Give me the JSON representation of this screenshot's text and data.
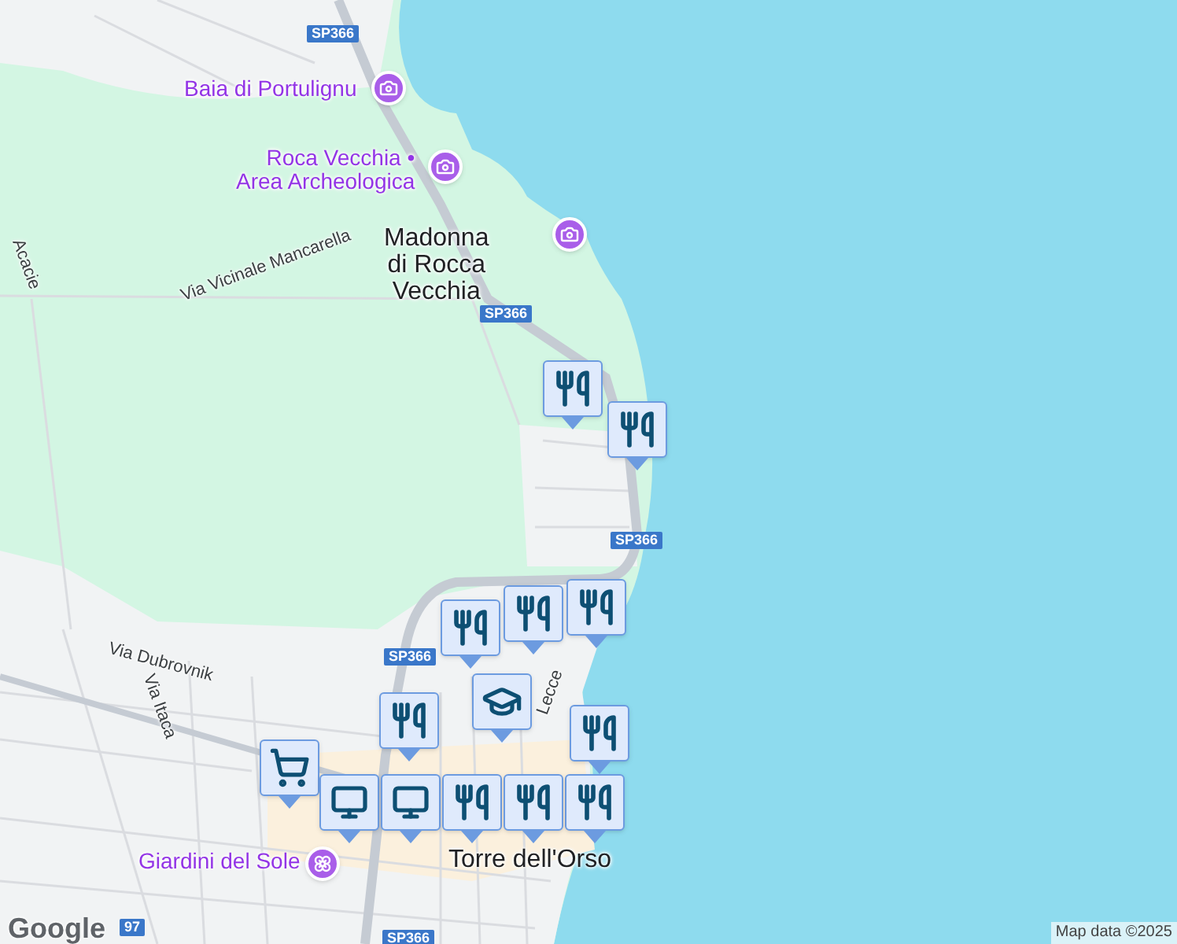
{
  "map": {
    "labels": [
      {
        "kind": "shield",
        "text": "SP366"
      },
      {
        "kind": "poi",
        "text": "Baia di Portulignu"
      },
      {
        "kind": "poi",
        "text": "Roca Vecchia •\nArea Archeologica"
      },
      {
        "kind": "place",
        "text": "Madonna\ndi Rocca\nVecchia"
      },
      {
        "kind": "road",
        "text": "Via Vicinale Mancarella"
      },
      {
        "kind": "road",
        "text": "Acacie"
      },
      {
        "kind": "shield",
        "text": "SP366"
      },
      {
        "kind": "shield",
        "text": "SP366"
      },
      {
        "kind": "shield",
        "text": "SP366"
      },
      {
        "kind": "road",
        "text": "Via Dubrovnik"
      },
      {
        "kind": "road",
        "text": "Via Itaca"
      },
      {
        "kind": "road",
        "text": "Lecce"
      },
      {
        "kind": "poi",
        "text": "Giardini del Sole"
      },
      {
        "kind": "place",
        "text": "Torre dell'Orso"
      },
      {
        "kind": "shield",
        "text": "97"
      },
      {
        "kind": "shield",
        "text": "SP366"
      }
    ],
    "pins": [
      {
        "kind": "camera"
      },
      {
        "kind": "camera"
      },
      {
        "kind": "camera"
      },
      {
        "kind": "garden"
      }
    ],
    "markers": [
      {
        "kind": "restaurant"
      },
      {
        "kind": "restaurant"
      },
      {
        "kind": "restaurant"
      },
      {
        "kind": "restaurant"
      },
      {
        "kind": "restaurant"
      },
      {
        "kind": "school"
      },
      {
        "kind": "restaurant"
      },
      {
        "kind": "restaurant"
      },
      {
        "kind": "shop"
      },
      {
        "kind": "computer"
      },
      {
        "kind": "computer"
      },
      {
        "kind": "restaurant"
      },
      {
        "kind": "restaurant"
      },
      {
        "kind": "restaurant"
      }
    ]
  },
  "logo": "Google",
  "attribution": "Map data ©2025"
}
